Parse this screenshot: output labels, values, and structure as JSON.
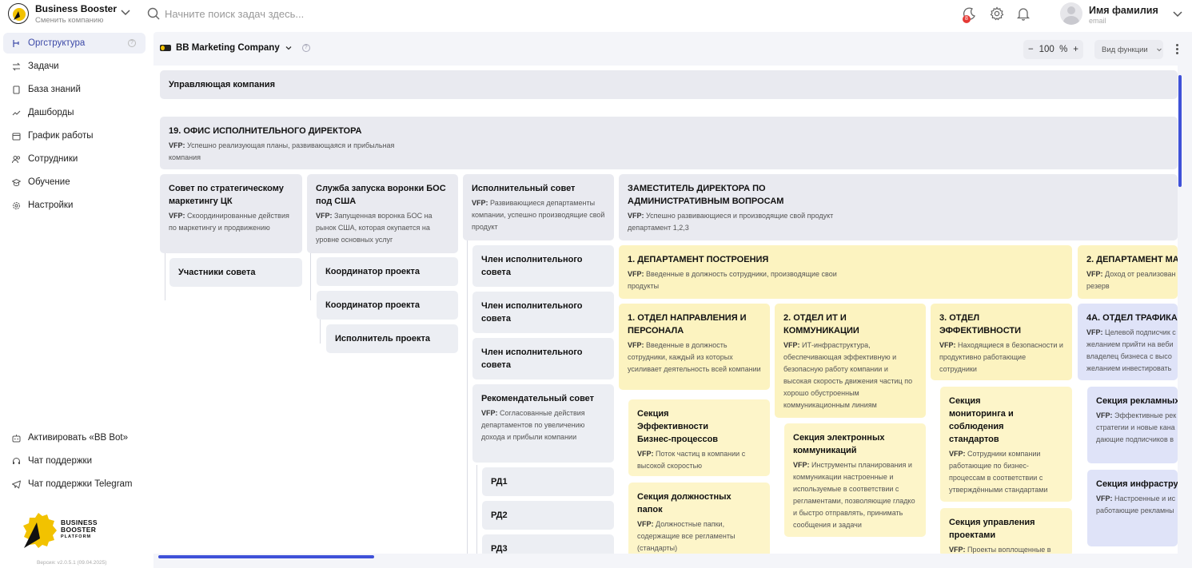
{
  "header": {
    "brand_name": "Business Booster",
    "brand_sub": "Сменить компанию",
    "search_placeholder": "Начните поиск задач здесь...",
    "notifications_badge": "8",
    "user_name": "Имя фамилия",
    "user_email": "email"
  },
  "sidebar": {
    "items": [
      {
        "label": "Оргструктура"
      },
      {
        "label": "Задачи"
      },
      {
        "label": "База знаний"
      },
      {
        "label": "Дашборды"
      },
      {
        "label": "График работы"
      },
      {
        "label": "Сотрудники"
      },
      {
        "label": "Обучение"
      },
      {
        "label": "Настройки"
      }
    ],
    "bottom_items": [
      {
        "label": "Активировать «BB Bot»"
      },
      {
        "label": "Чат поддержки"
      },
      {
        "label": "Чат поддержки Telegram"
      }
    ],
    "logo_lines": [
      "BUSINESS",
      "BOOSTER",
      "PLATFORM"
    ],
    "version": "Версия: v2.0.5.1 (09.04.2025)"
  },
  "toolbar": {
    "company": "BB Marketing Company",
    "zoom_value": "100",
    "zoom_unit": "%",
    "zoom_minus": "−",
    "zoom_plus": "+",
    "view_label": "Вид функции"
  },
  "vfp": "VFP:",
  "org": {
    "management": "Управляющая компания",
    "office": {
      "title": "19. ОФИС ИСПОЛНИТЕЛЬНОГО ДИРЕКТОРА",
      "vfp": "Успешно реализующая планы, развивающаяся и прибыльная компания"
    },
    "council": {
      "title": "Совет по стратегическому маркетингу ЦК",
      "vfp": "Скоординированные действия по маркетингу и продвижению"
    },
    "council_members": "Участники совета",
    "launch": {
      "title": "Служба запуска воронки БОС под США",
      "vfp": "Запущенная воронка БОС на рынок США, которая окупается на уровне основных услуг"
    },
    "coord1": "Координатор проекта",
    "coord2": "Координатор проекта",
    "executor": "Исполнитель проекта",
    "exec_council": {
      "title": "Исполнительный совет",
      "vfp": "Развивающиеся департаменты компании, успешно производящие свой продукт"
    },
    "member1": "Член исполнительного совета",
    "member2": "Член исполнительного совета",
    "member3": "Член исполнительного совета",
    "advisory": {
      "title": "Рекомендательный совет",
      "vfp": "Согласованные действия департаментов по увеличению дохода и прибыли компании"
    },
    "rd1": "РД1",
    "rd2": "РД2",
    "rd3": "РД3",
    "deputy": {
      "title": "ЗАМЕСТИТЕЛЬ ДИРЕКТОРА ПО АДМИНИСТРАТИВНЫМ ВОПРОСАМ",
      "vfp": "Успешно развивающиеся и производящие свой продукт департамент 1,2,3"
    },
    "dept1": {
      "title": "1. ДЕПАРТАМЕНТ ПОСТРОЕНИЯ",
      "vfp": "Введенные в должность сотрудники, производящие свои продукты"
    },
    "dept2": {
      "title": "2. ДЕПАРТАМЕНТ МА",
      "vfp": "Доход от реализован резерв"
    },
    "otdel1": {
      "title": "1. ОТДЕЛ НАПРАВЛЕНИЯ И ПЕРСОНАЛА",
      "vfp": "Введенные в должность сотрудники, каждый из которых усиливает деятельность всей компании"
    },
    "otdel2": {
      "title": "2. ОТДЕЛ ИТ И КОММУНИКАЦИИ",
      "vfp": "ИТ-инфраструктура, обеспечивающая эффективную и безопасную работу компании и высокая скорость движения частиц по хорошо обустроенным коммуникационным линиям"
    },
    "otdel3": {
      "title": "3. ОТДЕЛ ЭФФЕКТИВНОСТИ",
      "vfp": "Находящиеся в безопасности и продуктивно работающие сотрудники"
    },
    "otdel4a": {
      "title": "4А. ОТДЕЛ ТРАФИКА",
      "vfp": "Целевой подписчик с желанием прийти на веби владелец бизнеса с высо желанием инвестировать"
    },
    "sec_bp": {
      "title": "Секция Эффективности Бизнес-процессов",
      "vfp": "Поток частиц в компании с высокой скоростью"
    },
    "sec_papki": {
      "title": "Секция должностных папок",
      "vfp": "Должностные папки, содержащие все регламенты (стандарты)"
    },
    "sec_ecomm": {
      "title": "Секция электронных коммуникаций",
      "vfp": "Инструменты планирования и коммуникации настроенные и используемые в соответствии с регламентами, позволяющие гладко и быстро отправлять, принимать сообщения и задачи"
    },
    "sec_monitor": {
      "title": "Секция мониторинга и соблюдения стандартов",
      "vfp": "Сотрудники компании работающие по бизнес-процессам в соответствии с утверждёнными стандартами"
    },
    "sec_projects": {
      "title": "Секция управления проектами",
      "vfp": "Проекты воплощенные в"
    },
    "sec_ads": {
      "title": "Секция рекламных стратегий",
      "vfp": "Эффективные рек стратегии и новые кана дающие подписчиков в"
    },
    "sec_infra": {
      "title": "Секция инфраструктуры рекламы",
      "vfp": "Настроенные и ис работающие рекламны"
    }
  }
}
